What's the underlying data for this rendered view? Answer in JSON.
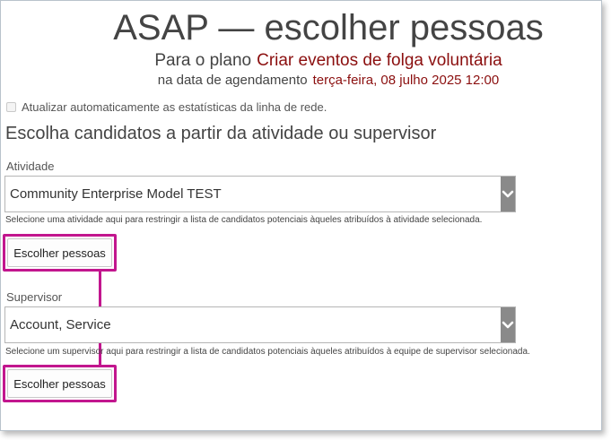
{
  "header": {
    "title": "ASAP — escolher pessoas",
    "plan_prefix": "Para o plano",
    "plan_name": "Criar eventos de folga voluntária",
    "date_prefix": "na data de agendamento",
    "date_value": "terça-feira, 08 julho 2025 12:00"
  },
  "auto_update": {
    "label": "Atualizar automaticamente as estatísticas da linha de rede.",
    "checked": false
  },
  "section_heading": "Escolha candidatos a partir da atividade ou supervisor",
  "activity": {
    "label": "Atividade",
    "selected": "Community Enterprise Model TEST",
    "help": "Selecione uma atividade aqui para restringir a lista de candidatos potenciais àqueles atribuídos à atividade selecionada.",
    "button": "Escolher pessoas"
  },
  "supervisor": {
    "label": "Supervisor",
    "selected": "Account, Service",
    "help": "Selecione um supervisor aqui para restringir a lista de candidatos potenciais àqueles atribuídos à equipe de supervisor selecionada.",
    "button": "Escolher pessoas"
  },
  "annotation": {
    "or_label": "OR",
    "color": "#c2168e"
  },
  "colors": {
    "accent": "#8b0f0f",
    "select_arrow_bg": "#8a8a8a"
  },
  "icons": {
    "select_arrow": "chevron-down-icon"
  }
}
